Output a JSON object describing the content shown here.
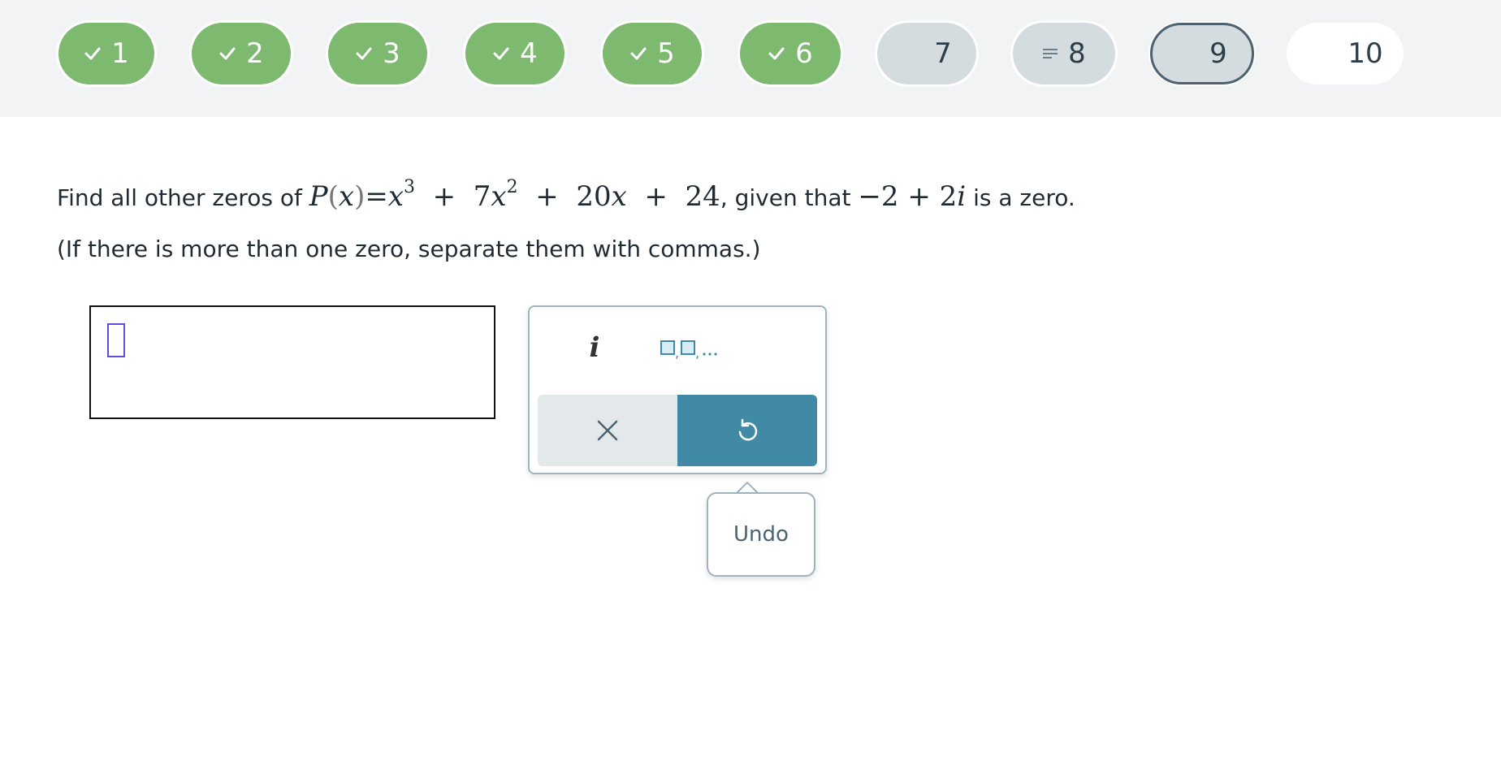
{
  "progress": {
    "items": [
      {
        "label": "1",
        "status": "complete"
      },
      {
        "label": "2",
        "status": "complete"
      },
      {
        "label": "3",
        "status": "complete"
      },
      {
        "label": "4",
        "status": "complete"
      },
      {
        "label": "5",
        "status": "complete"
      },
      {
        "label": "6",
        "status": "complete"
      },
      {
        "label": "7",
        "status": "unanswered"
      },
      {
        "label": "8",
        "status": "in-progress"
      },
      {
        "label": "9",
        "status": "current"
      },
      {
        "label": "10",
        "status": "not-visited"
      }
    ]
  },
  "question": {
    "prefix": "Find all other zeros of",
    "poly_P": "P",
    "poly_open": "(",
    "poly_x": "x",
    "poly_close": ")",
    "poly_eq": "=",
    "t1_base": "x",
    "t1_exp": "3",
    "plus1": "+",
    "t2_coef": "7",
    "t2_base": "x",
    "t2_exp": "2",
    "plus2": "+",
    "t3_coef": "20",
    "t3_base": "x",
    "plus3": "+",
    "t4": "24",
    "comma": ",",
    "given": "given that",
    "zero_neg": "−2",
    "plus4": "+",
    "zero_imag_coef": "2",
    "zero_imag": "i",
    "suffix": "is a zero.",
    "instruction": "(If there is more than one zero, separate them with commas.)"
  },
  "answer": {
    "value": ""
  },
  "keypad": {
    "i_key": "i",
    "list_key_icon": "comma-separated-list-icon",
    "clear_icon": "close-icon",
    "undo_icon": "undo-icon"
  },
  "tooltip": {
    "text": "Undo"
  },
  "colors": {
    "complete": "#7db96f",
    "pending": "#d5dcdf",
    "accent": "#408aa5",
    "caret": "#5b4fe0"
  }
}
